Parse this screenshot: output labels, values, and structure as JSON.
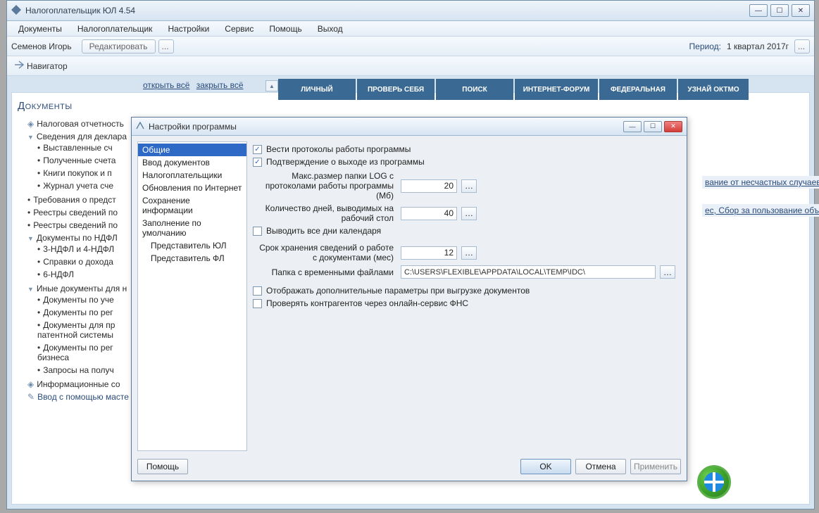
{
  "window": {
    "title": "Налогоплательщик ЮЛ 4.54"
  },
  "menu": [
    "Документы",
    "Налогоплательщик",
    "Настройки",
    "Сервис",
    "Помощь",
    "Выход"
  ],
  "toolbar": {
    "user": "Семенов Игорь",
    "edit": "Редактировать",
    "ellipsis": "...",
    "period_label": "Период:",
    "period_value": "1 квартал 2017г"
  },
  "navigator": "Навигатор",
  "links": {
    "open_all": "открыть всё",
    "close_all": "закрыть всё"
  },
  "tabs": [
    "ЛИЧНЫЙ",
    "ПРОВЕРЬ СЕБЯ",
    "ПОИСК",
    "ИНТЕРНЕТ-ФОРУМ",
    "ФЕДЕРАЛЬНАЯ",
    "УЗНАЙ ОКТМО"
  ],
  "sidebar": {
    "title": "Документы",
    "items": [
      "Налоговая отчетность",
      "Сведения для деклара",
      "Выставленные сч",
      "Полученные счета",
      "Книги покупок и п",
      "Журнал учета сче",
      "Требования о предст",
      "Реестры сведений по",
      "Реестры сведений по",
      "Документы по НДФЛ",
      "3-НДФЛ и 4-НДФЛ",
      "Справки о дохода",
      "6-НДФЛ",
      "Иные документы для н",
      "Документы по уче",
      "Документы по рег",
      "Документы для пр патентной системы",
      "Документы по рег бизнеса",
      "Запросы на получ",
      "Информационные со",
      "Ввод с помощью масте"
    ]
  },
  "peek": {
    "p1": "вание от несчастных случаев на",
    "p2": "ес, Сбор за пользование объекта"
  },
  "dialog": {
    "title": "Настройки программы",
    "left": {
      "items": [
        "Общие",
        "Ввод документов",
        "Налогоплательщики",
        "Обновления по Интернет",
        "Сохранение информации",
        "Заполнение по умолчанию",
        "Представитель ЮЛ",
        "Представитель ФЛ"
      ],
      "selected": 0
    },
    "right": {
      "chk_protocol": "Вести протоколы работы программы",
      "chk_confirm": "Подтверждение о выходе из программы",
      "lbl_logmax": "Макс.размер папки LOG с протоколами работы программы (Мб)",
      "val_logmax": "20",
      "lbl_days": "Количество дней, выводимых на рабочий стол",
      "val_days": "40",
      "chk_all_days": "Выводить все дни календаря",
      "lbl_months": "Срок хранения сведений о работе с документами (мес)",
      "val_months": "12",
      "lbl_temp": "Папка с временными файлами",
      "val_temp": "C:\\USERS\\FLEXIBLE\\APPDATA\\LOCAL\\TEMP\\IDC\\",
      "chk_extra": "Отображать дополнительные параметры при выгрузке документов",
      "chk_fns": "Проверять контрагентов через онлайн-сервис ФНС"
    },
    "buttons": {
      "help": "Помощь",
      "ok": "OK",
      "cancel": "Отмена",
      "apply": "Применить"
    }
  }
}
